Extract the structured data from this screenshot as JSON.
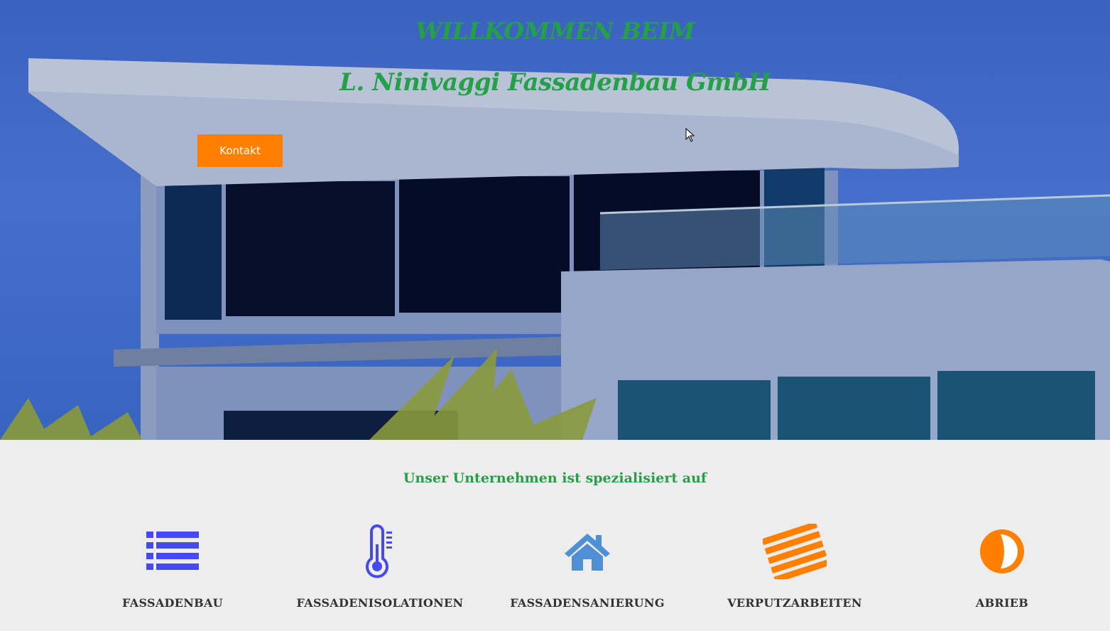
{
  "hero": {
    "title_line1": "WILLKOMMEN BEIM",
    "title_line2": "L. Ninivaggi Fassadenbau GmbH",
    "contact_button": "Kontakt"
  },
  "services": {
    "heading": "Unser Unternehmen ist spezialisiert auf",
    "items": [
      {
        "label": "FASSADENBAU",
        "icon": "list-icon",
        "color": "#4649f0"
      },
      {
        "label": "FASSADENISOLATIONEN",
        "icon": "thermometer-icon",
        "color": "#4649f0"
      },
      {
        "label": "FASSADENSANIERUNG",
        "icon": "home-icon",
        "color": "#4f8fd3"
      },
      {
        "label": "VERPUTZARBEITEN",
        "icon": "stripes-icon",
        "color": "#ff7f00"
      },
      {
        "label": "ABRIEB",
        "icon": "contrast-icon",
        "color": "#ff7f00"
      }
    ]
  },
  "colors": {
    "accent_green": "#24a048",
    "button_orange": "#ff7f00"
  }
}
